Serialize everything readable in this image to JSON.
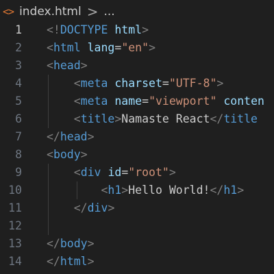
{
  "breadcrumb": {
    "file_icon": "<>",
    "filename": "index.html",
    "separator": ">",
    "more": "..."
  },
  "editor": {
    "lines": [
      {
        "number": "1",
        "tokens": [
          {
            "t": "punc",
            "v": "<!"
          },
          {
            "t": "tag",
            "v": "DOCTYPE"
          },
          {
            "t": "text",
            "v": " "
          },
          {
            "t": "attr",
            "v": "html"
          },
          {
            "t": "punc",
            "v": ">"
          }
        ]
      },
      {
        "number": "2",
        "tokens": [
          {
            "t": "punc",
            "v": "<"
          },
          {
            "t": "tag",
            "v": "html"
          },
          {
            "t": "text",
            "v": " "
          },
          {
            "t": "attr",
            "v": "lang"
          },
          {
            "t": "text",
            "v": "="
          },
          {
            "t": "str",
            "v": "\"en\""
          },
          {
            "t": "punc",
            "v": ">"
          }
        ]
      },
      {
        "number": "3",
        "tokens": [
          {
            "t": "punc",
            "v": "<"
          },
          {
            "t": "tag",
            "v": "head"
          },
          {
            "t": "punc",
            "v": ">"
          }
        ]
      },
      {
        "number": "4",
        "tokens": [
          {
            "t": "text",
            "v": "    "
          },
          {
            "t": "punc",
            "v": "<"
          },
          {
            "t": "tag",
            "v": "meta"
          },
          {
            "t": "text",
            "v": " "
          },
          {
            "t": "attr",
            "v": "charset"
          },
          {
            "t": "text",
            "v": "="
          },
          {
            "t": "str",
            "v": "\"UTF-8\""
          },
          {
            "t": "punc",
            "v": ">"
          }
        ]
      },
      {
        "number": "5",
        "tokens": [
          {
            "t": "text",
            "v": "    "
          },
          {
            "t": "punc",
            "v": "<"
          },
          {
            "t": "tag",
            "v": "meta"
          },
          {
            "t": "text",
            "v": " "
          },
          {
            "t": "attr",
            "v": "name"
          },
          {
            "t": "text",
            "v": "="
          },
          {
            "t": "str",
            "v": "\"viewport\""
          },
          {
            "t": "text",
            "v": " "
          },
          {
            "t": "attr",
            "v": "conten"
          }
        ]
      },
      {
        "number": "6",
        "tokens": [
          {
            "t": "text",
            "v": "    "
          },
          {
            "t": "punc",
            "v": "<"
          },
          {
            "t": "tag",
            "v": "title"
          },
          {
            "t": "punc",
            "v": ">"
          },
          {
            "t": "text",
            "v": "Namaste React"
          },
          {
            "t": "punc",
            "v": "</"
          },
          {
            "t": "tag",
            "v": "title"
          }
        ]
      },
      {
        "number": "7",
        "tokens": [
          {
            "t": "punc",
            "v": "</"
          },
          {
            "t": "tag",
            "v": "head"
          },
          {
            "t": "punc",
            "v": ">"
          }
        ]
      },
      {
        "number": "8",
        "tokens": [
          {
            "t": "punc",
            "v": "<"
          },
          {
            "t": "tag",
            "v": "body"
          },
          {
            "t": "punc",
            "v": ">"
          }
        ]
      },
      {
        "number": "9",
        "tokens": [
          {
            "t": "text",
            "v": "    "
          },
          {
            "t": "punc",
            "v": "<"
          },
          {
            "t": "tag",
            "v": "div"
          },
          {
            "t": "text",
            "v": " "
          },
          {
            "t": "attr",
            "v": "id"
          },
          {
            "t": "text",
            "v": "="
          },
          {
            "t": "str",
            "v": "\"root\""
          },
          {
            "t": "punc",
            "v": ">"
          }
        ]
      },
      {
        "number": "10",
        "tokens": [
          {
            "t": "text",
            "v": "        "
          },
          {
            "t": "punc",
            "v": "<"
          },
          {
            "t": "tag",
            "v": "h1"
          },
          {
            "t": "punc",
            "v": ">"
          },
          {
            "t": "text",
            "v": "Hello World!"
          },
          {
            "t": "punc",
            "v": "</"
          },
          {
            "t": "tag",
            "v": "h1"
          },
          {
            "t": "punc",
            "v": ">"
          }
        ]
      },
      {
        "number": "11",
        "tokens": [
          {
            "t": "text",
            "v": "    "
          },
          {
            "t": "punc",
            "v": "</"
          },
          {
            "t": "tag",
            "v": "div"
          },
          {
            "t": "punc",
            "v": ">"
          }
        ]
      },
      {
        "number": "12",
        "tokens": []
      },
      {
        "number": "13",
        "tokens": [
          {
            "t": "punc",
            "v": "</"
          },
          {
            "t": "tag",
            "v": "body"
          },
          {
            "t": "punc",
            "v": ">"
          }
        ]
      },
      {
        "number": "14",
        "tokens": [
          {
            "t": "punc",
            "v": "</"
          },
          {
            "t": "tag",
            "v": "html"
          },
          {
            "t": "punc",
            "v": ">"
          }
        ]
      }
    ],
    "active_line": "1"
  }
}
